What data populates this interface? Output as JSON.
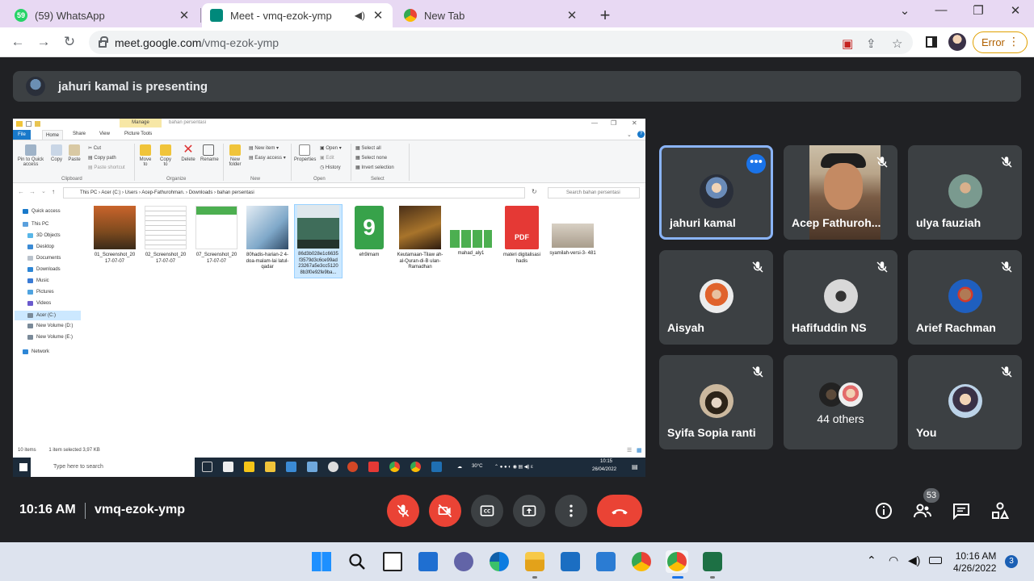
{
  "browser": {
    "tabs": [
      {
        "title": "(59) WhatsApp",
        "favicon_text": "59"
      },
      {
        "title": "Meet - vmq-ezok-ymp"
      },
      {
        "title": "New Tab"
      }
    ],
    "url_host": "meet.google.com",
    "url_path": "/vmq-ezok-ymp",
    "error_label": "Error"
  },
  "meet": {
    "presenting_banner": "jahuri kamal is presenting",
    "meeting_time": "10:16 AM",
    "meeting_code": "vmq-ezok-ymp",
    "people_count": "53",
    "participants": [
      {
        "name": "jahuri kamal"
      },
      {
        "name": "Acep Fathuroh..."
      },
      {
        "name": "ulya fauziah"
      },
      {
        "name": "Aisyah"
      },
      {
        "name": "Hafifuddin NS"
      },
      {
        "name": "Arief Rachman"
      },
      {
        "name": "Syifa Sopia ranti"
      },
      {
        "name": "44 others"
      },
      {
        "name": "You"
      }
    ]
  },
  "explorer": {
    "context_tab": "Manage",
    "window_title": "bahan persentasi",
    "ribbon_tabs": [
      "File",
      "Home",
      "Share",
      "View",
      "Picture Tools"
    ],
    "ribbon": {
      "pin": "Pin to Quick access",
      "copy": "Copy",
      "paste": "Paste",
      "cut": "Cut",
      "copy_path": "Copy path",
      "paste_shortcut": "Paste shortcut",
      "move_to": "Move to",
      "copy_to": "Copy to",
      "delete": "Delete",
      "rename": "Rename",
      "new_folder": "New folder",
      "new_item": "New item",
      "easy_access": "Easy access",
      "properties": "Properties",
      "open": "Open",
      "edit": "Edit",
      "history": "History",
      "select_all": "Select all",
      "select_none": "Select none",
      "invert_selection": "Invert selection",
      "groups": [
        "Clipboard",
        "Organize",
        "New",
        "Open",
        "Select"
      ]
    },
    "address": "This PC  ›  Acer (C:)  ›  Users  ›  Acep-Fathurohman.  ›  Downloads  ›  bahan persentasi",
    "search_placeholder": "Search bahan persentasi",
    "nav": [
      "Quick access",
      "This PC",
      "3D Objects",
      "Desktop",
      "Documents",
      "Downloads",
      "Music",
      "Pictures",
      "Videos",
      "Acer (C:)",
      "New Volume (D:)",
      "New Volume (E:)",
      "Network"
    ],
    "files": [
      {
        "name": "01_Screenshot_20 17-07-07"
      },
      {
        "name": "02_Screenshot_20 17-07-07"
      },
      {
        "name": "07_Screenshot_20 17-07-07"
      },
      {
        "name": "80hadis-harian-2 4-doa-malam-lai latul-qadar"
      },
      {
        "name": "86d3b028e1c6635 f3579d3c6ce99ad 23267a5e3cc5120 8b3f0e92fe9ba..."
      },
      {
        "name": "eh9imam"
      },
      {
        "name": "Keutamaan-Tilaw ah-al-Quran-di-B ulan-Ramadhan"
      },
      {
        "name": "mahad_aly1"
      },
      {
        "name": "materi digitalisasi hadis"
      },
      {
        "name": "syamilah-versi-3- 481"
      }
    ],
    "pdf_label": "PDF",
    "status_items": "10 items",
    "status_selected": "1 item selected  3,97 KB",
    "taskbar_search": "Type here to search",
    "taskbar_temp": "30°C",
    "taskbar_time": "10:15",
    "taskbar_date": "26/04/2022"
  },
  "windows": {
    "time": "10:16 AM",
    "date": "4/26/2022",
    "notifications": "3"
  }
}
